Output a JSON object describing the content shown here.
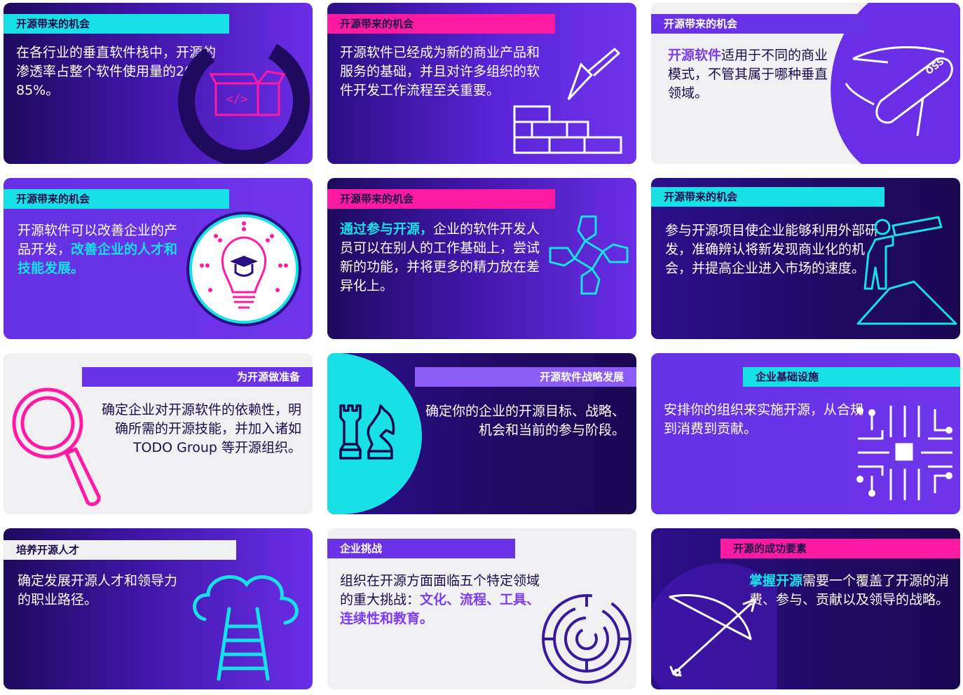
{
  "cards": [
    {
      "tag": "开源带来的机会",
      "text": "在各行业的垂直软件栈中，开源的渗透率占整个软件使用量的20-85%。",
      "icon": "open-box-code-icon"
    },
    {
      "tag": "开源带来的机会",
      "text": "开源软件已经成为新的商业产品和服务的基础，并且对许多组织的软件开发工作流程至关重要。",
      "icon": "trowel-brick-wall-icon"
    },
    {
      "tag": "开源带来的机会",
      "highlight": "开源软件",
      "text": "适用于不同的商业模式，不管其属于哪种垂直领域。",
      "icon": "oss-pocket-knife-icon",
      "icon_label": "OSS"
    },
    {
      "tag": "开源带来的机会",
      "text": "开源软件可以改善企业的产品开发，",
      "highlight": "改善企业的人才和技能发展。",
      "icon": "lightbulb-graduation-cap-icon"
    },
    {
      "tag": "开源带来的机会",
      "highlight": "通过参与开源，",
      "text": "企业的软件开发人员可以在别人的工作基础上，尝试新的功能，并将更多的精力放在差异化上。",
      "icon": "hands-together-icon"
    },
    {
      "tag": "开源带来的机会",
      "text": "参与开源项目使企业能够利用外部研发，准确辨认将新发现商业化的机会，并提高企业进入市场的速度。",
      "icon": "person-telescope-icon"
    },
    {
      "tag": "为开源做准备",
      "text": "确定企业对开源软件的依赖性，明确所需的开源技能，并加入诸如 TODO Group 等开源组织。",
      "icon": "magnifying-glass-icon"
    },
    {
      "tag": "开源软件战略发展",
      "text": "确定你的企业的开源目标、战略、机会和当前的参与阶段。",
      "icon": "chess-pieces-icon"
    },
    {
      "tag": "企业基础设施",
      "text": "安排你的组织来实施开源，从合规到消费到贡献。",
      "icon": "circuit-network-icon"
    },
    {
      "tag": "培养开源人才",
      "text": "确定发展开源人才和领导力的职业路径。",
      "icon": "cloud-ladder-icon"
    },
    {
      "tag": "企业挑战",
      "text": "组织在开源方面面临五个特定领域的重大挑战：",
      "highlight": "文化、流程、工具、连续性和教育。",
      "icon": "maze-icon"
    },
    {
      "tag": "开源的成功要素",
      "highlight": "掌握开源",
      "text": "需要一个覆盖了开源的消费、参与、贡献以及领导的战略。",
      "icon": "bow-and-arrow-icon"
    }
  ]
}
